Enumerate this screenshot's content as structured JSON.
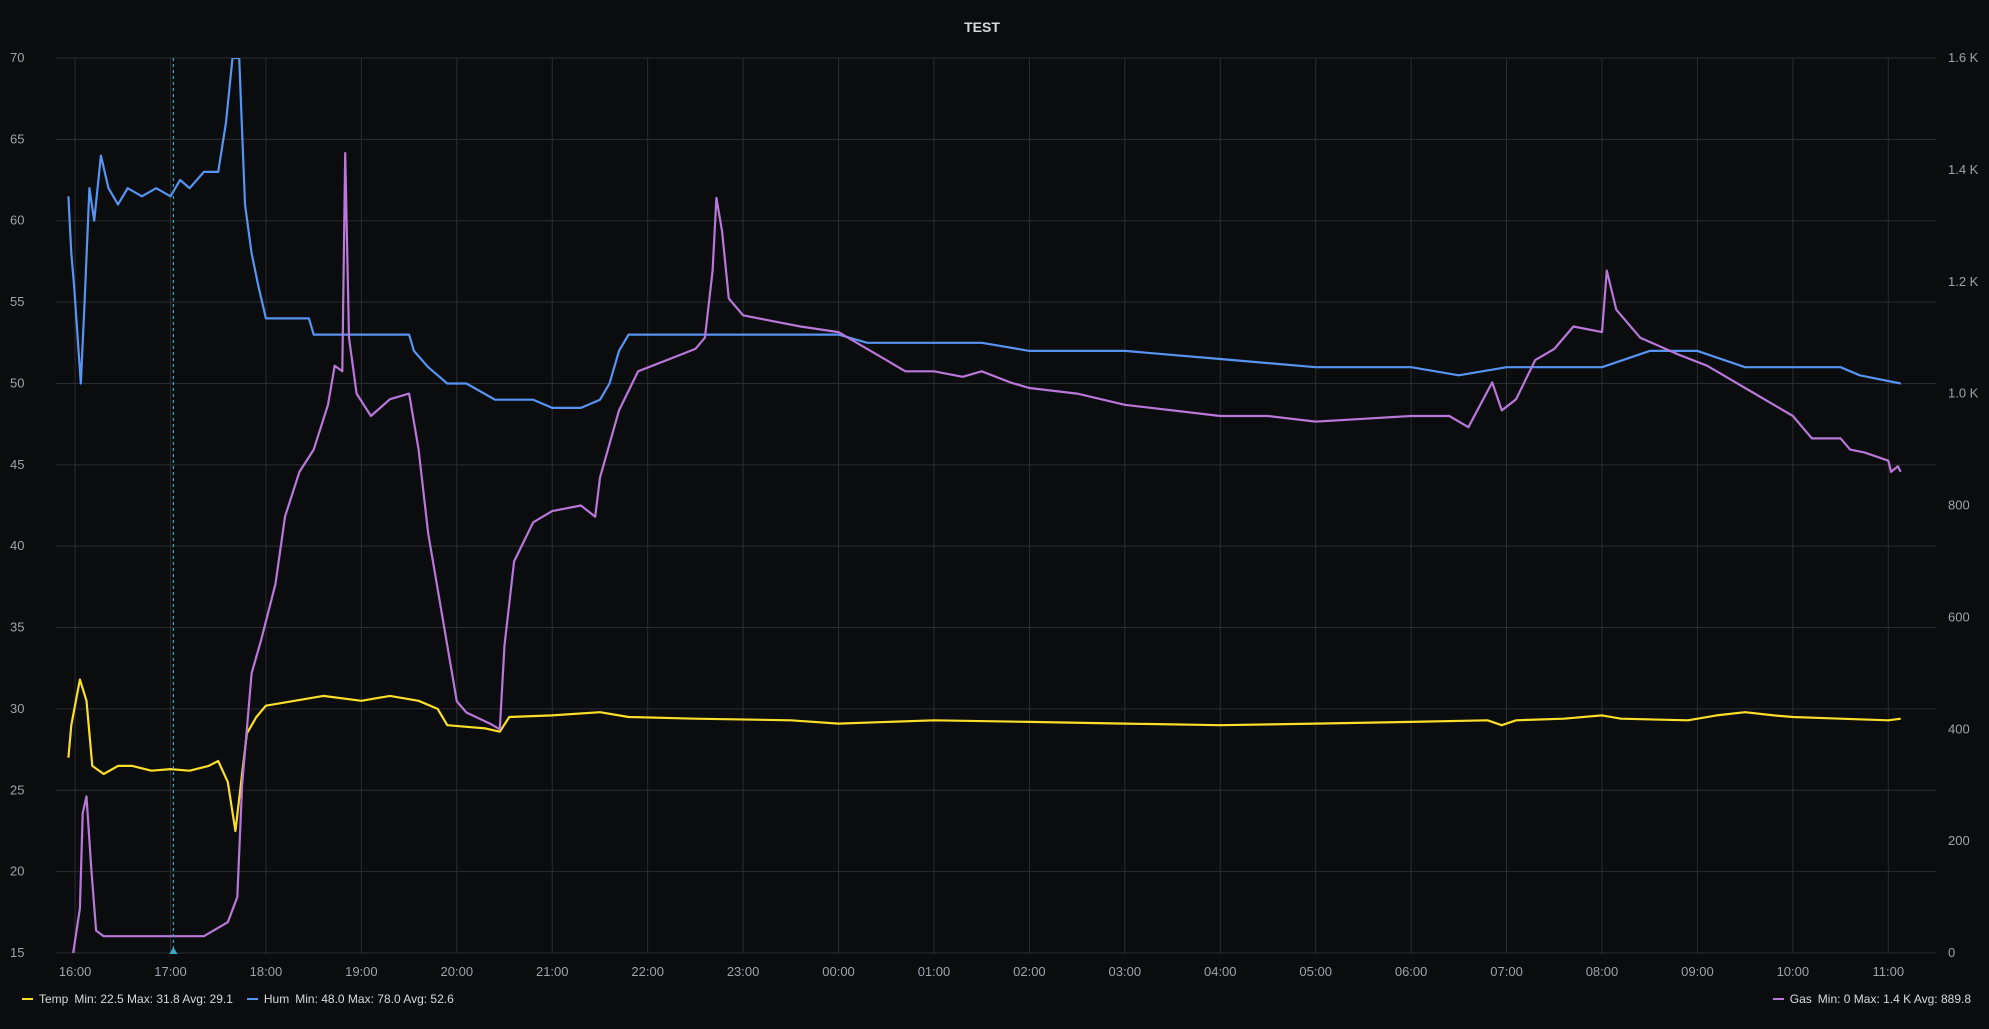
{
  "chart_data": {
    "type": "line",
    "title": "TEST",
    "x_ticks": [
      "16:00",
      "17:00",
      "18:00",
      "19:00",
      "20:00",
      "21:00",
      "22:00",
      "23:00",
      "00:00",
      "01:00",
      "02:00",
      "03:00",
      "04:00",
      "05:00",
      "06:00",
      "07:00",
      "08:00",
      "09:00",
      "10:00",
      "11:00"
    ],
    "x_range": [
      15.8,
      35.5
    ],
    "left_axis": {
      "ticks": [
        "70",
        "65",
        "60",
        "55",
        "50",
        "45",
        "40",
        "35",
        "30",
        "25",
        "20",
        "15"
      ],
      "range": [
        15,
        70
      ]
    },
    "right_axis": {
      "ticks": [
        "1.6 K",
        "1.4 K",
        "1.2 K",
        "1.0 K",
        "800",
        "600",
        "400",
        "200",
        "0"
      ],
      "range": [
        0,
        1600
      ]
    },
    "cursor_x": 17.03,
    "series": [
      {
        "name": "Temp",
        "axis": "left",
        "color": "#fade2a",
        "points": [
          [
            15.93,
            27
          ],
          [
            15.96,
            29
          ],
          [
            16.05,
            31.8
          ],
          [
            16.12,
            30.5
          ],
          [
            16.18,
            26.5
          ],
          [
            16.3,
            26
          ],
          [
            16.45,
            26.5
          ],
          [
            16.6,
            26.5
          ],
          [
            16.8,
            26.2
          ],
          [
            17.0,
            26.3
          ],
          [
            17.2,
            26.2
          ],
          [
            17.4,
            26.5
          ],
          [
            17.5,
            26.8
          ],
          [
            17.6,
            25.5
          ],
          [
            17.68,
            22.5
          ],
          [
            17.75,
            26
          ],
          [
            17.8,
            28.5
          ],
          [
            17.9,
            29.5
          ],
          [
            18.0,
            30.2
          ],
          [
            18.3,
            30.5
          ],
          [
            18.6,
            30.8
          ],
          [
            19.0,
            30.5
          ],
          [
            19.3,
            30.8
          ],
          [
            19.6,
            30.5
          ],
          [
            19.8,
            30
          ],
          [
            19.9,
            29
          ],
          [
            20.1,
            28.9
          ],
          [
            20.3,
            28.8
          ],
          [
            20.45,
            28.6
          ],
          [
            20.55,
            29.5
          ],
          [
            21.0,
            29.6
          ],
          [
            21.5,
            29.8
          ],
          [
            21.8,
            29.5
          ],
          [
            22.5,
            29.4
          ],
          [
            23.5,
            29.3
          ],
          [
            24.0,
            29.1
          ],
          [
            25.0,
            29.3
          ],
          [
            26.0,
            29.2
          ],
          [
            27.0,
            29.1
          ],
          [
            28.0,
            29.0
          ],
          [
            29.0,
            29.1
          ],
          [
            30.0,
            29.2
          ],
          [
            30.8,
            29.3
          ],
          [
            30.95,
            29.0
          ],
          [
            31.1,
            29.3
          ],
          [
            31.6,
            29.4
          ],
          [
            32.0,
            29.6
          ],
          [
            32.2,
            29.4
          ],
          [
            32.9,
            29.3
          ],
          [
            33.2,
            29.6
          ],
          [
            33.5,
            29.8
          ],
          [
            33.8,
            29.6
          ],
          [
            34.0,
            29.5
          ],
          [
            34.5,
            29.4
          ],
          [
            35.0,
            29.3
          ],
          [
            35.13,
            29.4
          ]
        ]
      },
      {
        "name": "Hum",
        "axis": "left",
        "color": "#5794f2",
        "points": [
          [
            15.93,
            61.5
          ],
          [
            15.96,
            58
          ],
          [
            15.99,
            56
          ],
          [
            16.06,
            50
          ],
          [
            16.1,
            55
          ],
          [
            16.15,
            62
          ],
          [
            16.2,
            60
          ],
          [
            16.27,
            64
          ],
          [
            16.35,
            62
          ],
          [
            16.45,
            61
          ],
          [
            16.55,
            62
          ],
          [
            16.7,
            61.5
          ],
          [
            16.85,
            62
          ],
          [
            17.0,
            61.5
          ],
          [
            17.1,
            62.5
          ],
          [
            17.2,
            62
          ],
          [
            17.35,
            63
          ],
          [
            17.5,
            63
          ],
          [
            17.58,
            66
          ],
          [
            17.65,
            70
          ],
          [
            17.72,
            70
          ],
          [
            17.78,
            61
          ],
          [
            17.85,
            58
          ],
          [
            17.92,
            56
          ],
          [
            18.0,
            54
          ],
          [
            18.45,
            54
          ],
          [
            18.5,
            53
          ],
          [
            19.0,
            53
          ],
          [
            19.5,
            53
          ],
          [
            19.55,
            52
          ],
          [
            19.7,
            51
          ],
          [
            19.9,
            50
          ],
          [
            20.1,
            50
          ],
          [
            20.4,
            49
          ],
          [
            20.8,
            49
          ],
          [
            21.0,
            48.5
          ],
          [
            21.3,
            48.5
          ],
          [
            21.5,
            49
          ],
          [
            21.6,
            50
          ],
          [
            21.7,
            52
          ],
          [
            21.8,
            53
          ],
          [
            22.3,
            53
          ],
          [
            22.5,
            53
          ],
          [
            23.0,
            53
          ],
          [
            24.0,
            53
          ],
          [
            24.3,
            52.5
          ],
          [
            25.0,
            52.5
          ],
          [
            25.5,
            52.5
          ],
          [
            26.0,
            52
          ],
          [
            27.0,
            52
          ],
          [
            28.0,
            51.5
          ],
          [
            29.0,
            51
          ],
          [
            30.0,
            51
          ],
          [
            30.5,
            50.5
          ],
          [
            31.0,
            51
          ],
          [
            31.5,
            51
          ],
          [
            32.0,
            51
          ],
          [
            32.5,
            52
          ],
          [
            33.0,
            52
          ],
          [
            33.5,
            51
          ],
          [
            34.0,
            51
          ],
          [
            34.5,
            51
          ],
          [
            34.7,
            50.5
          ],
          [
            35.13,
            50
          ]
        ]
      },
      {
        "name": "Gas",
        "axis": "right",
        "color": "#b877d9",
        "points": [
          [
            15.98,
            0
          ],
          [
            16.05,
            80
          ],
          [
            16.08,
            250
          ],
          [
            16.12,
            280
          ],
          [
            16.17,
            150
          ],
          [
            16.22,
            40
          ],
          [
            16.3,
            30
          ],
          [
            17.0,
            30
          ],
          [
            17.35,
            30
          ],
          [
            17.5,
            45
          ],
          [
            17.6,
            55
          ],
          [
            17.7,
            100
          ],
          [
            17.75,
            300
          ],
          [
            17.85,
            500
          ],
          [
            17.95,
            560
          ],
          [
            18.1,
            660
          ],
          [
            18.2,
            780
          ],
          [
            18.35,
            860
          ],
          [
            18.5,
            900
          ],
          [
            18.65,
            980
          ],
          [
            18.72,
            1050
          ],
          [
            18.8,
            1040
          ],
          [
            18.83,
            1430
          ],
          [
            18.87,
            1100
          ],
          [
            18.95,
            1000
          ],
          [
            19.1,
            960
          ],
          [
            19.3,
            990
          ],
          [
            19.5,
            1000
          ],
          [
            19.6,
            900
          ],
          [
            19.7,
            750
          ],
          [
            19.85,
            600
          ],
          [
            20.0,
            450
          ],
          [
            20.1,
            430
          ],
          [
            20.35,
            410
          ],
          [
            20.45,
            400
          ],
          [
            20.5,
            550
          ],
          [
            20.6,
            700
          ],
          [
            20.8,
            770
          ],
          [
            21.0,
            790
          ],
          [
            21.3,
            800
          ],
          [
            21.45,
            780
          ],
          [
            21.5,
            850
          ],
          [
            21.7,
            970
          ],
          [
            21.9,
            1040
          ],
          [
            22.2,
            1060
          ],
          [
            22.5,
            1080
          ],
          [
            22.6,
            1100
          ],
          [
            22.68,
            1220
          ],
          [
            22.72,
            1350
          ],
          [
            22.78,
            1290
          ],
          [
            22.85,
            1170
          ],
          [
            23.0,
            1140
          ],
          [
            23.3,
            1130
          ],
          [
            23.6,
            1120
          ],
          [
            24.0,
            1110
          ],
          [
            24.3,
            1080
          ],
          [
            24.5,
            1060
          ],
          [
            24.7,
            1040
          ],
          [
            25.0,
            1040
          ],
          [
            25.3,
            1030
          ],
          [
            25.5,
            1040
          ],
          [
            25.8,
            1020
          ],
          [
            26.0,
            1010
          ],
          [
            26.5,
            1000
          ],
          [
            27.0,
            980
          ],
          [
            27.5,
            970
          ],
          [
            28.0,
            960
          ],
          [
            28.5,
            960
          ],
          [
            29.0,
            950
          ],
          [
            29.5,
            955
          ],
          [
            30.0,
            960
          ],
          [
            30.4,
            960
          ],
          [
            30.6,
            940
          ],
          [
            30.85,
            1020
          ],
          [
            30.95,
            970
          ],
          [
            31.1,
            990
          ],
          [
            31.3,
            1060
          ],
          [
            31.5,
            1080
          ],
          [
            31.7,
            1120
          ],
          [
            32.0,
            1110
          ],
          [
            32.05,
            1220
          ],
          [
            32.15,
            1150
          ],
          [
            32.4,
            1100
          ],
          [
            32.8,
            1070
          ],
          [
            33.1,
            1050
          ],
          [
            33.3,
            1030
          ],
          [
            33.5,
            1010
          ],
          [
            33.8,
            980
          ],
          [
            34.0,
            960
          ],
          [
            34.2,
            920
          ],
          [
            34.5,
            920
          ],
          [
            34.6,
            900
          ],
          [
            34.75,
            895
          ],
          [
            35.0,
            880
          ],
          [
            35.03,
            860
          ],
          [
            35.1,
            870
          ],
          [
            35.13,
            860
          ]
        ]
      }
    ],
    "legend": [
      {
        "name": "Temp",
        "color": "#fade2a",
        "stats": "Min: 22.5  Max: 31.8  Avg: 29.1"
      },
      {
        "name": "Hum",
        "color": "#5794f2",
        "stats": "Min: 48.0  Max: 78.0  Avg: 52.6"
      },
      {
        "name": "Gas",
        "color": "#b877d9",
        "stats": "Min: 0  Max: 1.4 K  Avg: 889.8"
      }
    ]
  }
}
